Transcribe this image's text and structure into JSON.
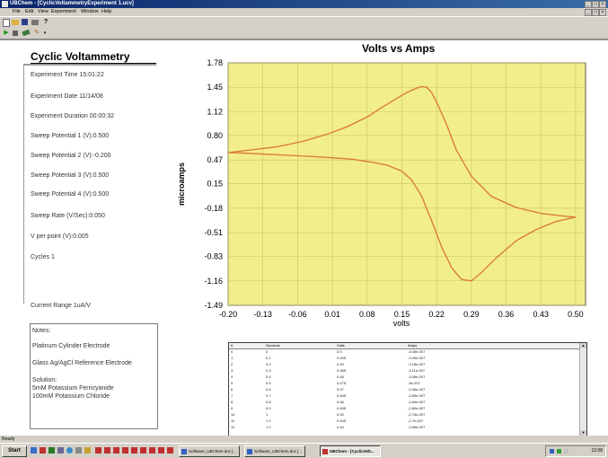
{
  "window": {
    "title": "UBChem - [CyclicVoltammetryExperiment 1.ucv]",
    "controls": [
      "_",
      "□",
      "×"
    ]
  },
  "menu": [
    "File",
    "Edit",
    "View",
    "Experiment",
    "Window",
    "Help"
  ],
  "menu_controls": [
    "_",
    "□",
    "×"
  ],
  "toolbar": {
    "row1_icons": [
      "new-icon",
      "open-icon",
      "save-icon",
      "print-icon",
      "help-icon"
    ],
    "row2_icons": [
      "run-icon",
      "stop-icon",
      "options-icon",
      "tools-icon"
    ]
  },
  "panel": {
    "title": "Cyclic Voltammetry",
    "params": [
      "Experiment Time 15:01:22",
      "Experiment Date 11/14/08",
      "Experiment Duration 00:00:32",
      "Sweep Potential 1 (V):0.500",
      "Sweep Potential 2 (V):-0.200",
      "Sweep Potential 3 (V):0.500",
      "Sweep Potential 4 (V):0.500",
      "Sweep Rate (V/Sec):0.050",
      "V per point (V):0.005",
      "Cycles 1"
    ],
    "current_range": "Current Range 1uA/V",
    "notes_label": "Notes:",
    "notes": [
      "Platinum Cylinder Electrode",
      "",
      "Glass Ag/AgCl Reference Electrode",
      "",
      "Solution:",
      "5mM Potassium Ferricyanide",
      "100mM Potassium Chloride"
    ]
  },
  "chart_data": {
    "type": "line",
    "title": "Volts vs Amps",
    "xlabel": "volts",
    "ylabel": "microamps",
    "xlim": [
      -0.2,
      0.52
    ],
    "ylim": [
      -1.49,
      1.78
    ],
    "x_ticks": [
      "-0.20",
      "-0.13",
      "-0.06",
      "0.01",
      "0.08",
      "0.15",
      "0.22",
      "0.29",
      "0.36",
      "0.43",
      "0.50"
    ],
    "y_ticks": [
      "1.78",
      "1.45",
      "1.12",
      "0.80",
      "0.47",
      "0.15",
      "-0.18",
      "-0.51",
      "-0.83",
      "-1.16",
      "-1.49"
    ],
    "grid": true,
    "plot_background": "#f2ee8a",
    "line_color": "#d9763a",
    "series": [
      {
        "name": "",
        "x": [
          0.5,
          0.46,
          0.42,
          0.38,
          0.34,
          0.31,
          0.29,
          0.27,
          0.25,
          0.23,
          0.21,
          0.19,
          0.17,
          0.15,
          0.12,
          0.09,
          0.05,
          0.01,
          -0.04,
          -0.1,
          -0.16,
          -0.2,
          -0.16,
          -0.1,
          -0.05,
          0.0,
          0.04,
          0.08,
          0.11,
          0.14,
          0.16,
          0.18,
          0.19,
          0.2,
          0.21,
          0.22,
          0.24,
          0.26,
          0.29,
          0.33,
          0.38,
          0.43,
          0.48,
          0.5
        ],
        "y": [
          -0.3,
          -0.36,
          -0.47,
          -0.62,
          -0.85,
          -1.05,
          -1.16,
          -1.14,
          -0.98,
          -0.7,
          -0.35,
          -0.02,
          0.2,
          0.32,
          0.4,
          0.44,
          0.48,
          0.5,
          0.52,
          0.54,
          0.56,
          0.57,
          0.6,
          0.65,
          0.72,
          0.82,
          0.92,
          1.05,
          1.18,
          1.3,
          1.38,
          1.44,
          1.46,
          1.45,
          1.38,
          1.25,
          0.95,
          0.6,
          0.25,
          -0.02,
          -0.17,
          -0.25,
          -0.29,
          -0.3
        ]
      }
    ]
  },
  "table": {
    "columns": [
      "#",
      "Seconds",
      "Volts",
      "Amps"
    ],
    "rows": [
      [
        "0",
        "0",
        "0.5",
        "-3.05e-007"
      ],
      [
        "1",
        "0.1",
        "0.495",
        "-3.25e-007"
      ],
      [
        "2",
        "0.2",
        "0.49",
        "-3.18e-007"
      ],
      [
        "3",
        "0.3",
        "0.485",
        "-3.11e-007"
      ],
      [
        "4",
        "0.4",
        "0.48",
        "-3.06e-007"
      ],
      [
        "5",
        "0.5",
        "0.475",
        "-3e-007"
      ],
      [
        "6",
        "0.6",
        "0.47",
        "-2.96e-007"
      ],
      [
        "7",
        "0.7",
        "0.465",
        "-2.89e-007"
      ],
      [
        "8",
        "0.8",
        "0.46",
        "-2.84e-007"
      ],
      [
        "9",
        "0.9",
        "0.455",
        "-2.80e-007"
      ],
      [
        "10",
        "1",
        "0.45",
        "-2.75e-007"
      ],
      [
        "11",
        "1.1",
        "0.445",
        "-2.7e-007"
      ],
      [
        "12",
        "1.2",
        "0.44",
        "-2.66e-007"
      ]
    ]
  },
  "status": "Ready",
  "taskbar": {
    "start": "Start",
    "tasks": [
      {
        "label": "Software_UBChem.doc [...",
        "active": false
      },
      {
        "label": "Software_UBChem.doc [...",
        "active": false
      },
      {
        "label": "UBChem - [CyclicVolt...",
        "active": true
      }
    ],
    "clock": "12:08"
  }
}
